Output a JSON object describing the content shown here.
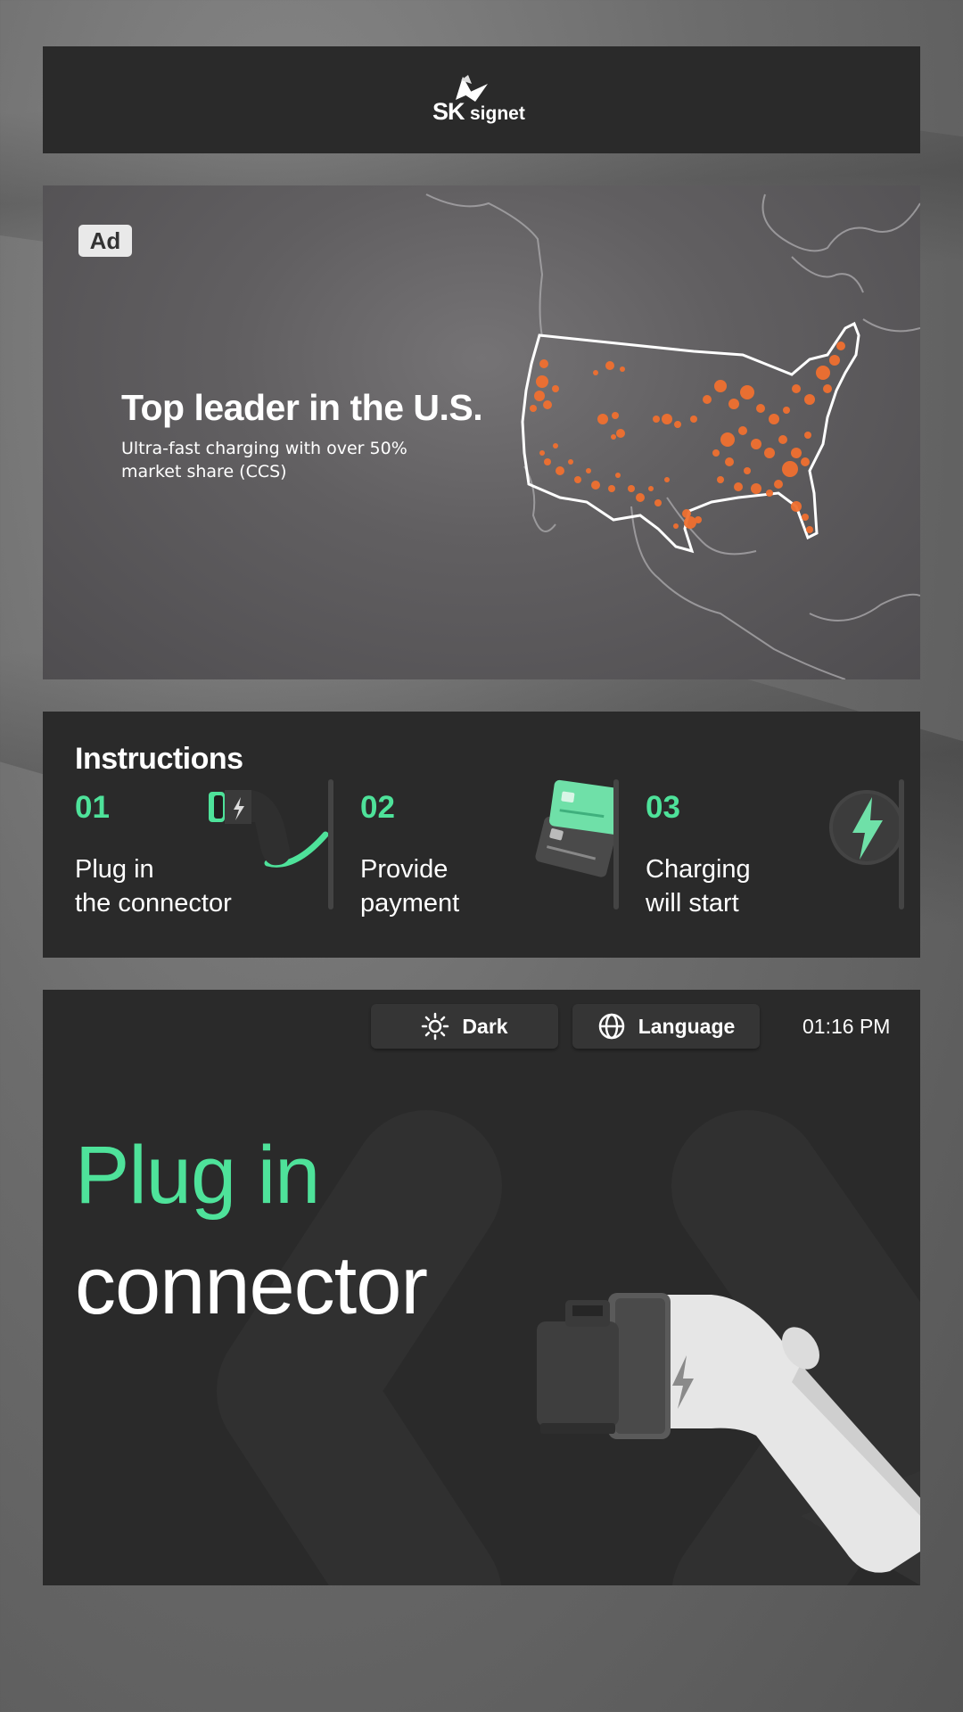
{
  "header": {
    "logo_sk": "SK",
    "logo_signet": "signet"
  },
  "ad": {
    "badge": "Ad",
    "title": "Top leader in the U.S.",
    "subtitle": "Ultra-fast charging with over 50% market share (CCS)",
    "accent_color": "#f07030"
  },
  "instructions": {
    "title": "Instructions",
    "steps": [
      {
        "number": "01",
        "label": "Plug in\nthe connector",
        "icon": "ev-plug-icon"
      },
      {
        "number": "02",
        "label": "Provide\npayment",
        "icon": "payment-cards-icon"
      },
      {
        "number": "03",
        "label": "Charging\nwill start",
        "icon": "lightning-icon"
      }
    ]
  },
  "main": {
    "theme_button": "Dark",
    "language_button": "Language",
    "time": "01:16 PM",
    "hero_line1": "Plug in",
    "hero_line2": "connector",
    "accent_color": "#4ee29a"
  }
}
